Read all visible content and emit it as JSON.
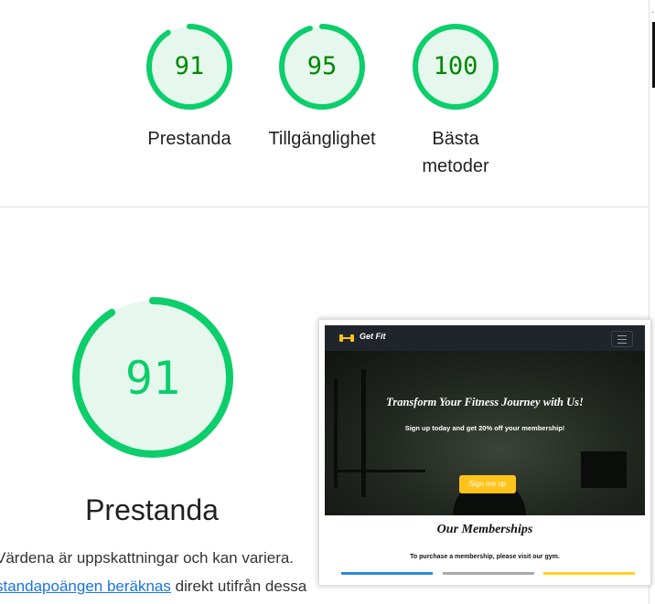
{
  "scores": [
    {
      "value": "91",
      "label": "Prestanda",
      "fraction": 0.91,
      "color": "#0cce6b"
    },
    {
      "value": "95",
      "label": "Tillgänglighet",
      "fraction": 0.95,
      "color": "#0cce6b"
    },
    {
      "value": "100",
      "label_line1": "Bästa",
      "label_line2": "metoder",
      "fraction": 1.0,
      "color": "#0cce6b"
    }
  ],
  "main_gauge": {
    "value": "91",
    "fraction": 0.91
  },
  "section_title": "Prestanda",
  "description": {
    "line1": "Värdena är uppskattningar och kan variera.",
    "link_text": "standapoängen beräknas",
    "line2_rest": " direkt utifrån dessa"
  },
  "screenshot": {
    "brand": "Get Fit",
    "hero_title": "Transform Your Fitness Journey with Us!",
    "hero_sub": "Sign up today and get 20% off your membership!",
    "hero_button": "Sign me up",
    "members_title": "Our Memberships",
    "members_sub": "To purchase a membership, please visit our gym."
  },
  "colors": {
    "pass_green": "#0cce6b",
    "pass_text": "#008800",
    "gauge_fill": "#e6f8ee",
    "link": "#1a73e8"
  }
}
